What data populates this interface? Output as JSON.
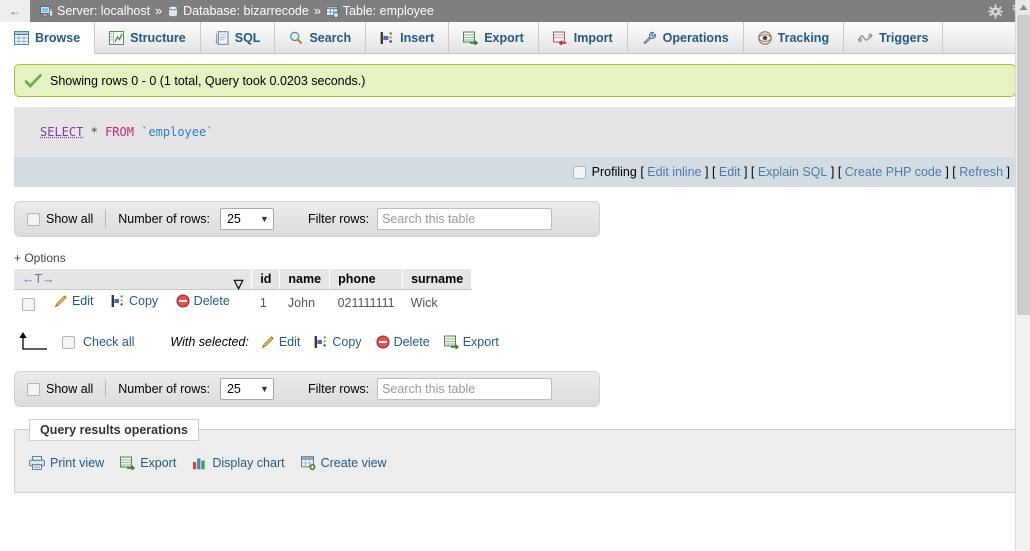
{
  "breadcrumb": {
    "back_label": "←",
    "items": [
      {
        "icon": "server-icon",
        "label": "Server: localhost"
      },
      {
        "icon": "database-icon",
        "label": "Database: bizarrecode"
      },
      {
        "icon": "table-icon",
        "label": "Table: employee"
      }
    ],
    "separator": "»",
    "settings_icon": "gear-icon",
    "collapse_icon": "collapse-icon"
  },
  "tabs": [
    {
      "label": "Browse",
      "icon": "browse-icon",
      "active": true
    },
    {
      "label": "Structure",
      "icon": "structure-icon",
      "active": false
    },
    {
      "label": "SQL",
      "icon": "sql-icon",
      "active": false
    },
    {
      "label": "Search",
      "icon": "search-icon",
      "active": false
    },
    {
      "label": "Insert",
      "icon": "insert-icon",
      "active": false
    },
    {
      "label": "Export",
      "icon": "export-icon",
      "active": false
    },
    {
      "label": "Import",
      "icon": "import-icon",
      "active": false
    },
    {
      "label": "Operations",
      "icon": "operations-icon",
      "active": false
    },
    {
      "label": "Tracking",
      "icon": "tracking-icon",
      "active": false
    },
    {
      "label": "Triggers",
      "icon": "triggers-icon",
      "active": false
    }
  ],
  "notice": {
    "icon": "success-check-icon",
    "text": "Showing rows 0 - 0 (1 total, Query took 0.0203 seconds.)"
  },
  "sql": {
    "select": "SELECT",
    "star": "*",
    "from": "FROM",
    "table": "`employee`"
  },
  "profiling": {
    "label": "Profiling",
    "open_bracket": "[",
    "close_bracket": "]",
    "links": [
      "Edit inline",
      "Edit",
      "Explain SQL",
      "Create PHP code",
      "Refresh"
    ]
  },
  "rows_toolbar": {
    "show_all_label": "Show all",
    "number_of_rows_label": "Number of rows:",
    "number_of_rows_value": "25",
    "filter_rows_label": "Filter rows:",
    "filter_placeholder": "Search this table"
  },
  "options_link": "+ Options",
  "table": {
    "nav_symbol": "←T→",
    "sort_caret": "▽",
    "columns": [
      "id",
      "name",
      "phone",
      "surname"
    ],
    "row_ops": [
      {
        "label": "Edit",
        "icon": "pencil-icon"
      },
      {
        "label": "Copy",
        "icon": "copy-icon"
      },
      {
        "label": "Delete",
        "icon": "delete-icon"
      }
    ],
    "rows": [
      {
        "id": "1",
        "name": "John",
        "phone": "021111111",
        "surname": "Wick"
      }
    ]
  },
  "check_all": {
    "arrow_icon": "up-left-arrow-icon",
    "label": "Check all",
    "with_selected_label": "With selected:",
    "actions": [
      {
        "label": "Edit",
        "icon": "pencil-icon"
      },
      {
        "label": "Copy",
        "icon": "copy-icon"
      },
      {
        "label": "Delete",
        "icon": "delete-icon"
      },
      {
        "label": "Export",
        "icon": "export-icon"
      }
    ]
  },
  "query_results_operations": {
    "legend": "Query results operations",
    "links": [
      {
        "label": "Print view",
        "icon": "printer-icon"
      },
      {
        "label": "Export",
        "icon": "export-icon"
      },
      {
        "label": "Display chart",
        "icon": "chart-icon"
      },
      {
        "label": "Create view",
        "icon": "create-view-icon"
      }
    ]
  },
  "colors": {
    "topbar": "#7f7f7f",
    "notice_bg": "#e5f2c2",
    "notice_border": "#a2c62f",
    "sql_bg": "#e5e5e5",
    "profiling_bg": "#d3dce3",
    "link": "#235a81",
    "tab_link": "#235a81"
  }
}
